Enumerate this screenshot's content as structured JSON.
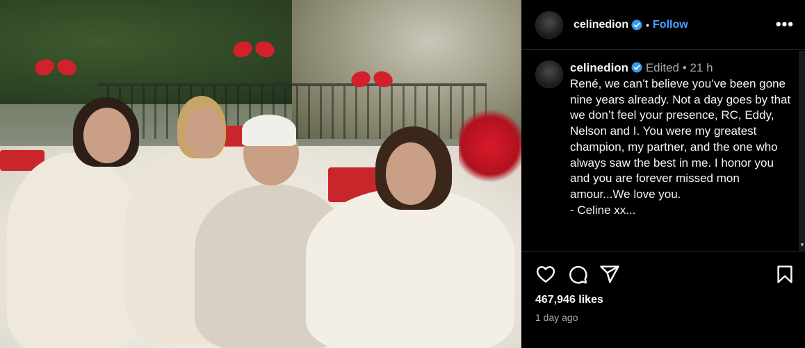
{
  "post": {
    "username": "celinedion",
    "follow_label": "Follow",
    "dot": "•",
    "more_label": "•••"
  },
  "caption": {
    "username": "celinedion",
    "edited_label": "Edited",
    "dot": "•",
    "time": "21 h",
    "text": "René, we can’t believe you’ve been gone nine years already. Not a day goes by that we don’t feel your presence, RC, Eddy, Nelson and I. You were my greatest champion, my partner, and the one who always saw the best in me. I honor you and you are forever missed mon amour...We love you.\n- Celine xx..."
  },
  "engagement": {
    "likes": "467,946 likes",
    "age": "1 day ago"
  },
  "icons": {
    "verified": "verified-badge-icon",
    "like": "heart-icon",
    "comment": "comment-icon",
    "share": "share-icon",
    "save": "bookmark-icon",
    "more": "more-icon"
  },
  "colors": {
    "background": "#000000",
    "link": "#4aa3ff",
    "verified": "#3897f0",
    "muted": "#a8a8a8"
  }
}
